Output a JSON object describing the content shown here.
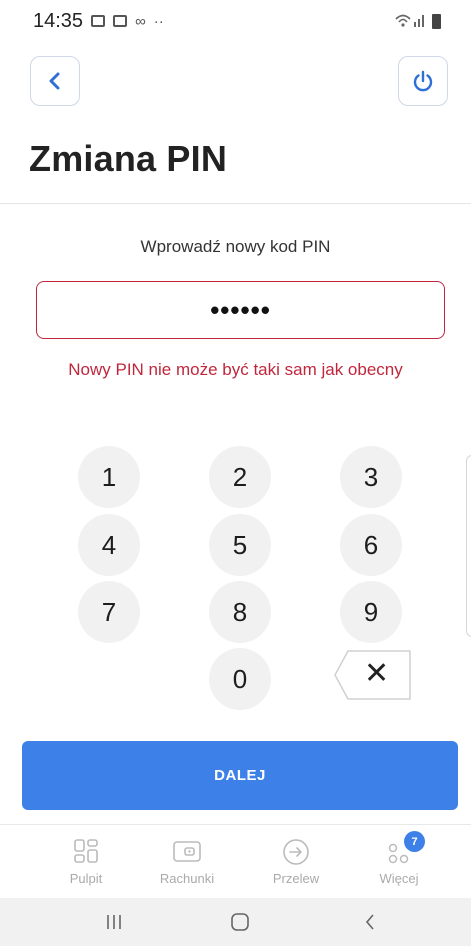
{
  "status_bar": {
    "time": "14:35",
    "dots": "··"
  },
  "header": {
    "title": "Zmiana PIN"
  },
  "pin": {
    "label": "Wprowadź nowy kod PIN",
    "masked_value": "••••••",
    "error": "Nowy PIN nie może być taki sam jak obecny"
  },
  "keypad": {
    "keys": [
      "1",
      "2",
      "3",
      "4",
      "5",
      "6",
      "7",
      "8",
      "9",
      "0"
    ],
    "clear_symbol": "✕"
  },
  "next_button": {
    "label": "DALEJ"
  },
  "bottom_nav": {
    "items": [
      {
        "label": "Pulpit",
        "icon": "dashboard-icon"
      },
      {
        "label": "Rachunki",
        "icon": "wallet-icon"
      },
      {
        "label": "Przelew",
        "icon": "transfer-arrow-icon"
      },
      {
        "label": "Więcej",
        "icon": "more-icon",
        "badge": "7"
      }
    ]
  },
  "colors": {
    "accent": "#3d80e8",
    "error": "#c0273d",
    "key_background": "#f1f1f1"
  }
}
